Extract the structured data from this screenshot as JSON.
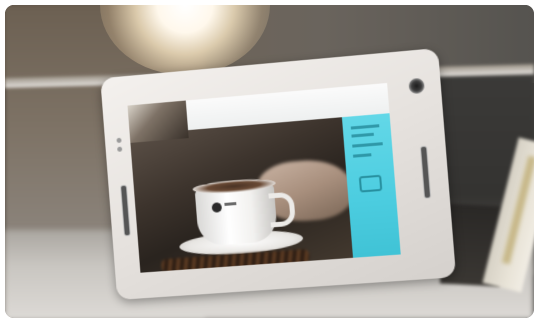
{
  "scene": {
    "description_icons": [
      "tablet-device",
      "camera-lens",
      "coffee-cup",
      "lamp-light"
    ],
    "colors": {
      "screen_panel": "#4ccde0",
      "tablet_body": "#e6e2de"
    }
  }
}
